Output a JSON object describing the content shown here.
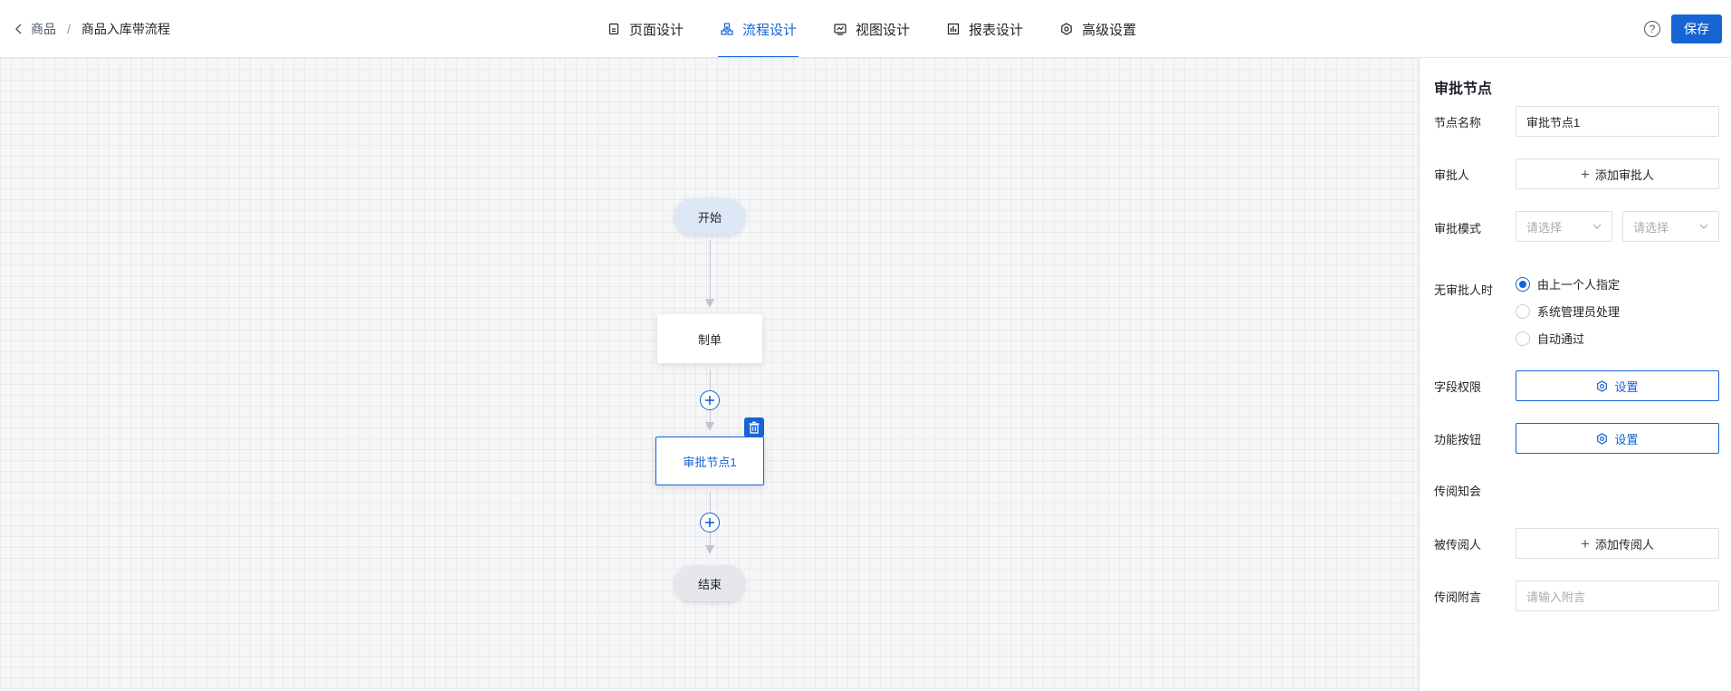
{
  "breadcrumb": {
    "parent": "商品",
    "separator": "/",
    "current": "商品入库带流程"
  },
  "tabs": [
    {
      "label": "页面设计",
      "icon": "page-icon"
    },
    {
      "label": "流程设计",
      "icon": "flow-icon",
      "active": true
    },
    {
      "label": "视图设计",
      "icon": "view-icon"
    },
    {
      "label": "报表设计",
      "icon": "report-icon"
    },
    {
      "label": "高级设置",
      "icon": "gear-icon"
    }
  ],
  "header": {
    "help": "?",
    "save_label": "保存"
  },
  "flow": {
    "start": "开始",
    "create": "制单",
    "approval": "审批节点1",
    "end": "结束"
  },
  "panel": {
    "title": "审批节点",
    "node_name_label": "节点名称",
    "node_name_value": "审批节点1",
    "approver_label": "审批人",
    "add_approver": "添加审批人",
    "mode_label": "审批模式",
    "mode_select_1": "请选择",
    "mode_select_2": "请选择",
    "no_approver_label": "无审批人时",
    "no_approver_options": [
      "由上一个人指定",
      "系统管理员处理",
      "自动通过"
    ],
    "no_approver_selected": 0,
    "field_perm_label": "字段权限",
    "func_btn_label": "功能按钮",
    "setting": "设置",
    "cc_label": "传阅知会",
    "cc_person_label": "被传阅人",
    "add_cc": "添加传阅人",
    "cc_note_label": "传阅附言",
    "cc_note_placeholder": "请输入附言"
  },
  "colors": {
    "accent": "#1664d4"
  }
}
